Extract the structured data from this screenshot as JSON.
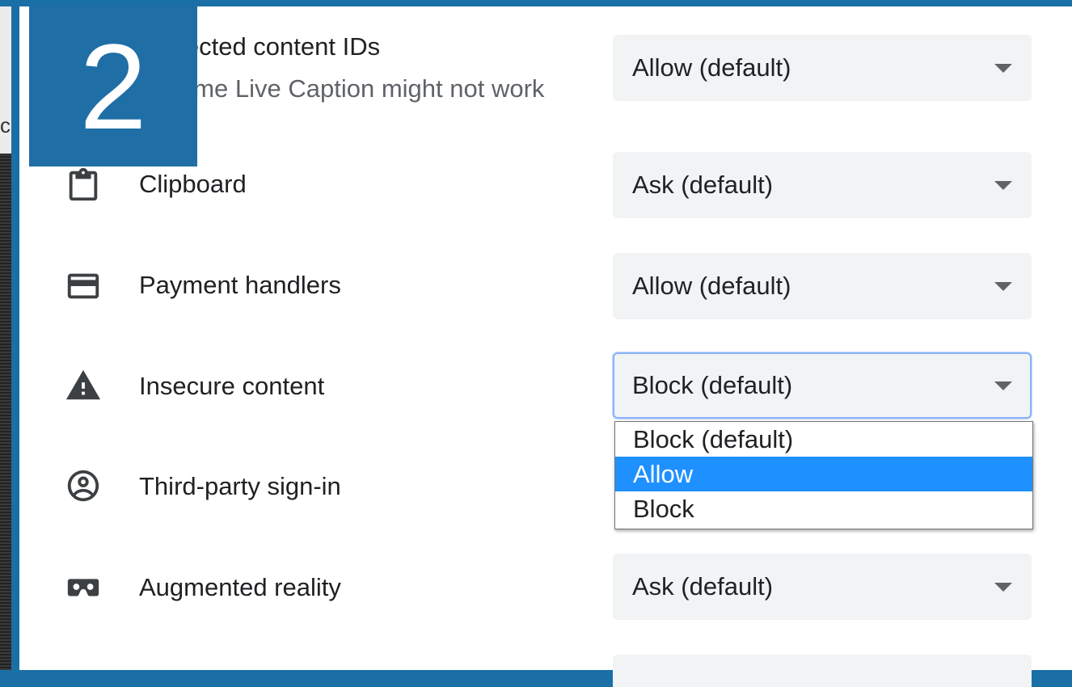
{
  "step_badge": "2",
  "left_glyph": "c",
  "colors": {
    "badge": "#1f6ea6",
    "highlight": "#1e90ff",
    "select_bg": "#f1f3f4",
    "focus_ring": "#8ab4f8"
  },
  "rows": [
    {
      "label": "Protected content IDs",
      "sublabel": "Chrome Live Caption might not work",
      "value": "Allow (default)",
      "icon": "protected-content-icon"
    },
    {
      "label": "Clipboard",
      "value": "Ask (default)",
      "icon": "clipboard-icon"
    },
    {
      "label": "Payment handlers",
      "value": "Allow (default)",
      "icon": "payment-card-icon"
    },
    {
      "label": "Insecure content",
      "value": "Block (default)",
      "icon": "warning-icon"
    },
    {
      "label": "Third-party sign-in",
      "value": "",
      "icon": "account-circle-icon"
    },
    {
      "label": "Augmented reality",
      "value": "Ask (default)",
      "icon": "vr-headset-icon"
    }
  ],
  "dropdown": {
    "options": [
      "Block (default)",
      "Allow",
      "Block"
    ],
    "highlighted_index": 1
  }
}
